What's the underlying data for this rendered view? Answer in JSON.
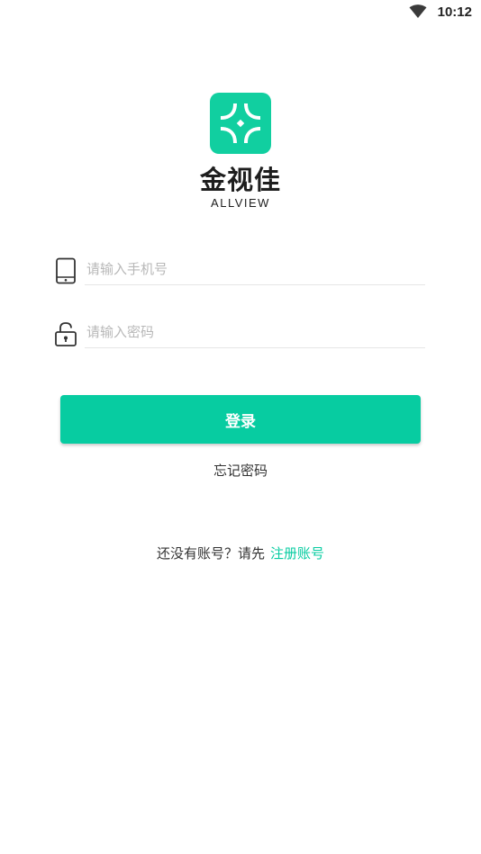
{
  "status_bar": {
    "time": "10:12",
    "signal_icon": "wifi-icon"
  },
  "brand": {
    "logo_icon": "app-logo-icon",
    "name": "金视佳",
    "subtitle": "ALLVIEW",
    "accent_color": "#07cca1"
  },
  "form": {
    "phone": {
      "icon": "phone-icon",
      "value": "",
      "placeholder": "请输入手机号"
    },
    "password": {
      "icon": "lock-icon",
      "value": "",
      "placeholder": "请输入密码"
    },
    "login_label": "登录",
    "forgot_label": "忘记密码"
  },
  "register": {
    "prompt": "还没有账号？请先",
    "link_label": "注册账号"
  }
}
